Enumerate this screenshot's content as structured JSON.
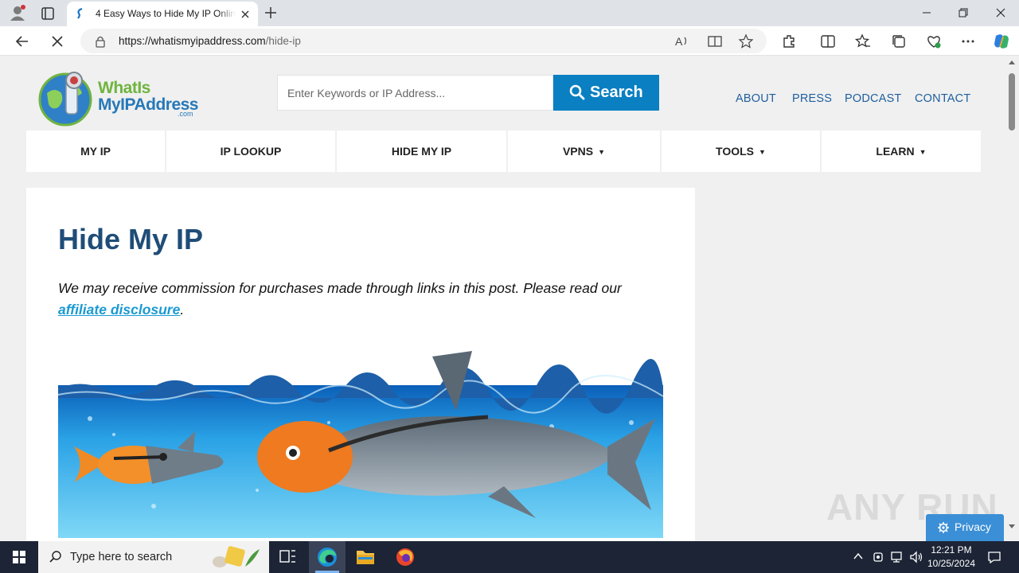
{
  "browser": {
    "tab_title": "4 Easy Ways to Hide My IP Online",
    "url_host": "https://whatismyipaddress.com",
    "url_path": "/hide-ip"
  },
  "site": {
    "logo": {
      "line1": "WhatIs",
      "line2": "MyIPAddress",
      "suffix": ".com"
    },
    "search": {
      "placeholder": "Enter Keywords or IP Address...",
      "button_label": "Search"
    },
    "top_links": [
      "ABOUT",
      "PRESS",
      "PODCAST",
      "CONTACT"
    ],
    "nav": [
      {
        "label": "MY IP",
        "dropdown": false
      },
      {
        "label": "IP LOOKUP",
        "dropdown": false
      },
      {
        "label": "HIDE MY IP",
        "dropdown": false
      },
      {
        "label": "VPNS",
        "dropdown": true
      },
      {
        "label": "TOOLS",
        "dropdown": true
      },
      {
        "label": "LEARN",
        "dropdown": true
      }
    ],
    "caret": "▼"
  },
  "article": {
    "title": "Hide My IP",
    "disclaimer_text": "We may receive commission for purchases made through links in this post. Please read our ",
    "disclaimer_link": "affiliate disclosure",
    "disclaimer_end": "."
  },
  "overlay": {
    "watermark": "ANY RUN",
    "privacy_label": "Privacy"
  },
  "taskbar": {
    "search_placeholder": "Type here to search",
    "time": "12:21 PM",
    "date": "10/25/2024"
  },
  "colors": {
    "brand_blue": "#0a7fc2",
    "nav_link": "#1e5f9f",
    "heading": "#1f4d78",
    "link": "#1b9ad2",
    "logo_green": "#6fb43f"
  }
}
